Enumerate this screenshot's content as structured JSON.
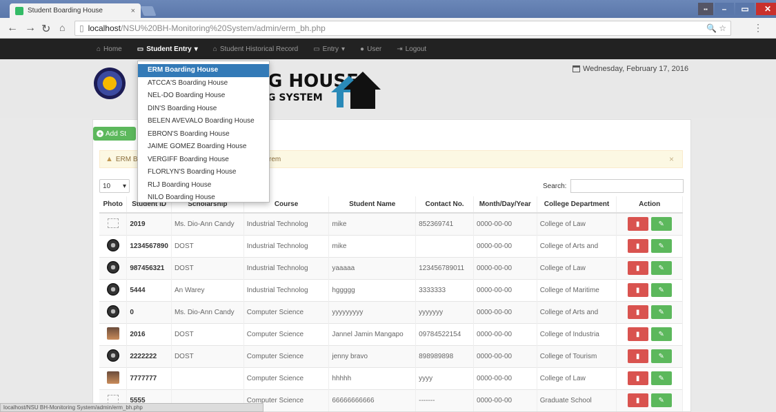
{
  "browser": {
    "tab_title": "Student Boarding House",
    "url_host": "localhost",
    "url_path": "/NSU%20BH-Monitoring%20System/admin/erm_bh.php"
  },
  "nav": {
    "home": "Home",
    "student_entry": "Student Entry",
    "historical": "Student Historical Record",
    "entry": "Entry",
    "user": "User",
    "logout": "Logout"
  },
  "header": {
    "logo_line1": "G HOUSE",
    "logo_line2": "G SYSTEM",
    "date": "Wednesday, February 17, 2016"
  },
  "dropdown": {
    "items": [
      "ERM Boarding House",
      "ATCCA'S Boarding House",
      "NEL-DO Boarding House",
      "DIN'S Boarding House",
      "BELEN AVEVALO Boarding House",
      "EBRON'S Boarding House",
      "JAIME GOMEZ Boarding House",
      "VERGIFF Boarding House",
      "FLORLYN'S Boarding House",
      "RLJ Boarding House",
      "NILO Boarding House"
    ]
  },
  "toolbar": {
    "add_label": "Add St",
    "alert_prefix": "ERM B",
    "alert_suffix": "rem",
    "length_value": "10",
    "search_label": "Search:"
  },
  "table": {
    "headers": [
      "Photo",
      "Student ID",
      "Scholarship",
      "Course",
      "Student Name",
      "Contact No.",
      "Month/Day/Year",
      "College Department",
      "Action"
    ],
    "rows": [
      {
        "photo": "broken",
        "id": "2019",
        "scholarship": "Ms. Dio-Ann Candy",
        "course": "Industrial Technolog",
        "name": "mike",
        "contact": "852369741",
        "date": "0000-00-00",
        "dept": "College of Law"
      },
      {
        "photo": "seal",
        "id": "1234567890",
        "scholarship": "DOST",
        "course": "Industrial Technolog",
        "name": "mike",
        "contact": "",
        "date": "0000-00-00",
        "dept": "College of Arts and"
      },
      {
        "photo": "seal",
        "id": "987456321",
        "scholarship": "DOST",
        "course": "Industrial Technolog",
        "name": "yaaaaa",
        "contact": "123456789011",
        "date": "0000-00-00",
        "dept": "College of Law"
      },
      {
        "photo": "seal",
        "id": "5444",
        "scholarship": "An Warey",
        "course": "Industrial Technolog",
        "name": "hggggg",
        "contact": "3333333",
        "date": "0000-00-00",
        "dept": "College of Maritime"
      },
      {
        "photo": "seal",
        "id": "0",
        "scholarship": "Ms. Dio-Ann Candy",
        "course": "Computer Science",
        "name": "yyyyyyyyy",
        "contact": "yyyyyyy",
        "date": "0000-00-00",
        "dept": "College of Arts and"
      },
      {
        "photo": "person",
        "id": "2016",
        "scholarship": "DOST",
        "course": "Computer Science",
        "name": "Jannel Jamin Mangapo",
        "contact": "09784522154",
        "date": "0000-00-00",
        "dept": "College of Industria"
      },
      {
        "photo": "seal",
        "id": "2222222",
        "scholarship": "DOST",
        "course": "Computer Science",
        "name": "jenny bravo",
        "contact": "898989898",
        "date": "0000-00-00",
        "dept": "College of Tourism"
      },
      {
        "photo": "person",
        "id": "7777777",
        "scholarship": "",
        "course": "Computer Science",
        "name": "hhhhh",
        "contact": "yyyy",
        "date": "0000-00-00",
        "dept": "College of Law"
      },
      {
        "photo": "broken",
        "id": "5555",
        "scholarship": "",
        "course": "Computer Science",
        "name": "66666666666",
        "contact": "-------",
        "date": "0000-00-00",
        "dept": "Graduate School"
      }
    ]
  },
  "statusbar": "localhost/NSU BH-Monitoring System/admin/erm_bh.php",
  "colors": {
    "navbar": "#222222",
    "primary": "#337ab7",
    "success": "#5cb85c",
    "danger": "#d9534f",
    "warning_bg": "#fcf8e3"
  }
}
